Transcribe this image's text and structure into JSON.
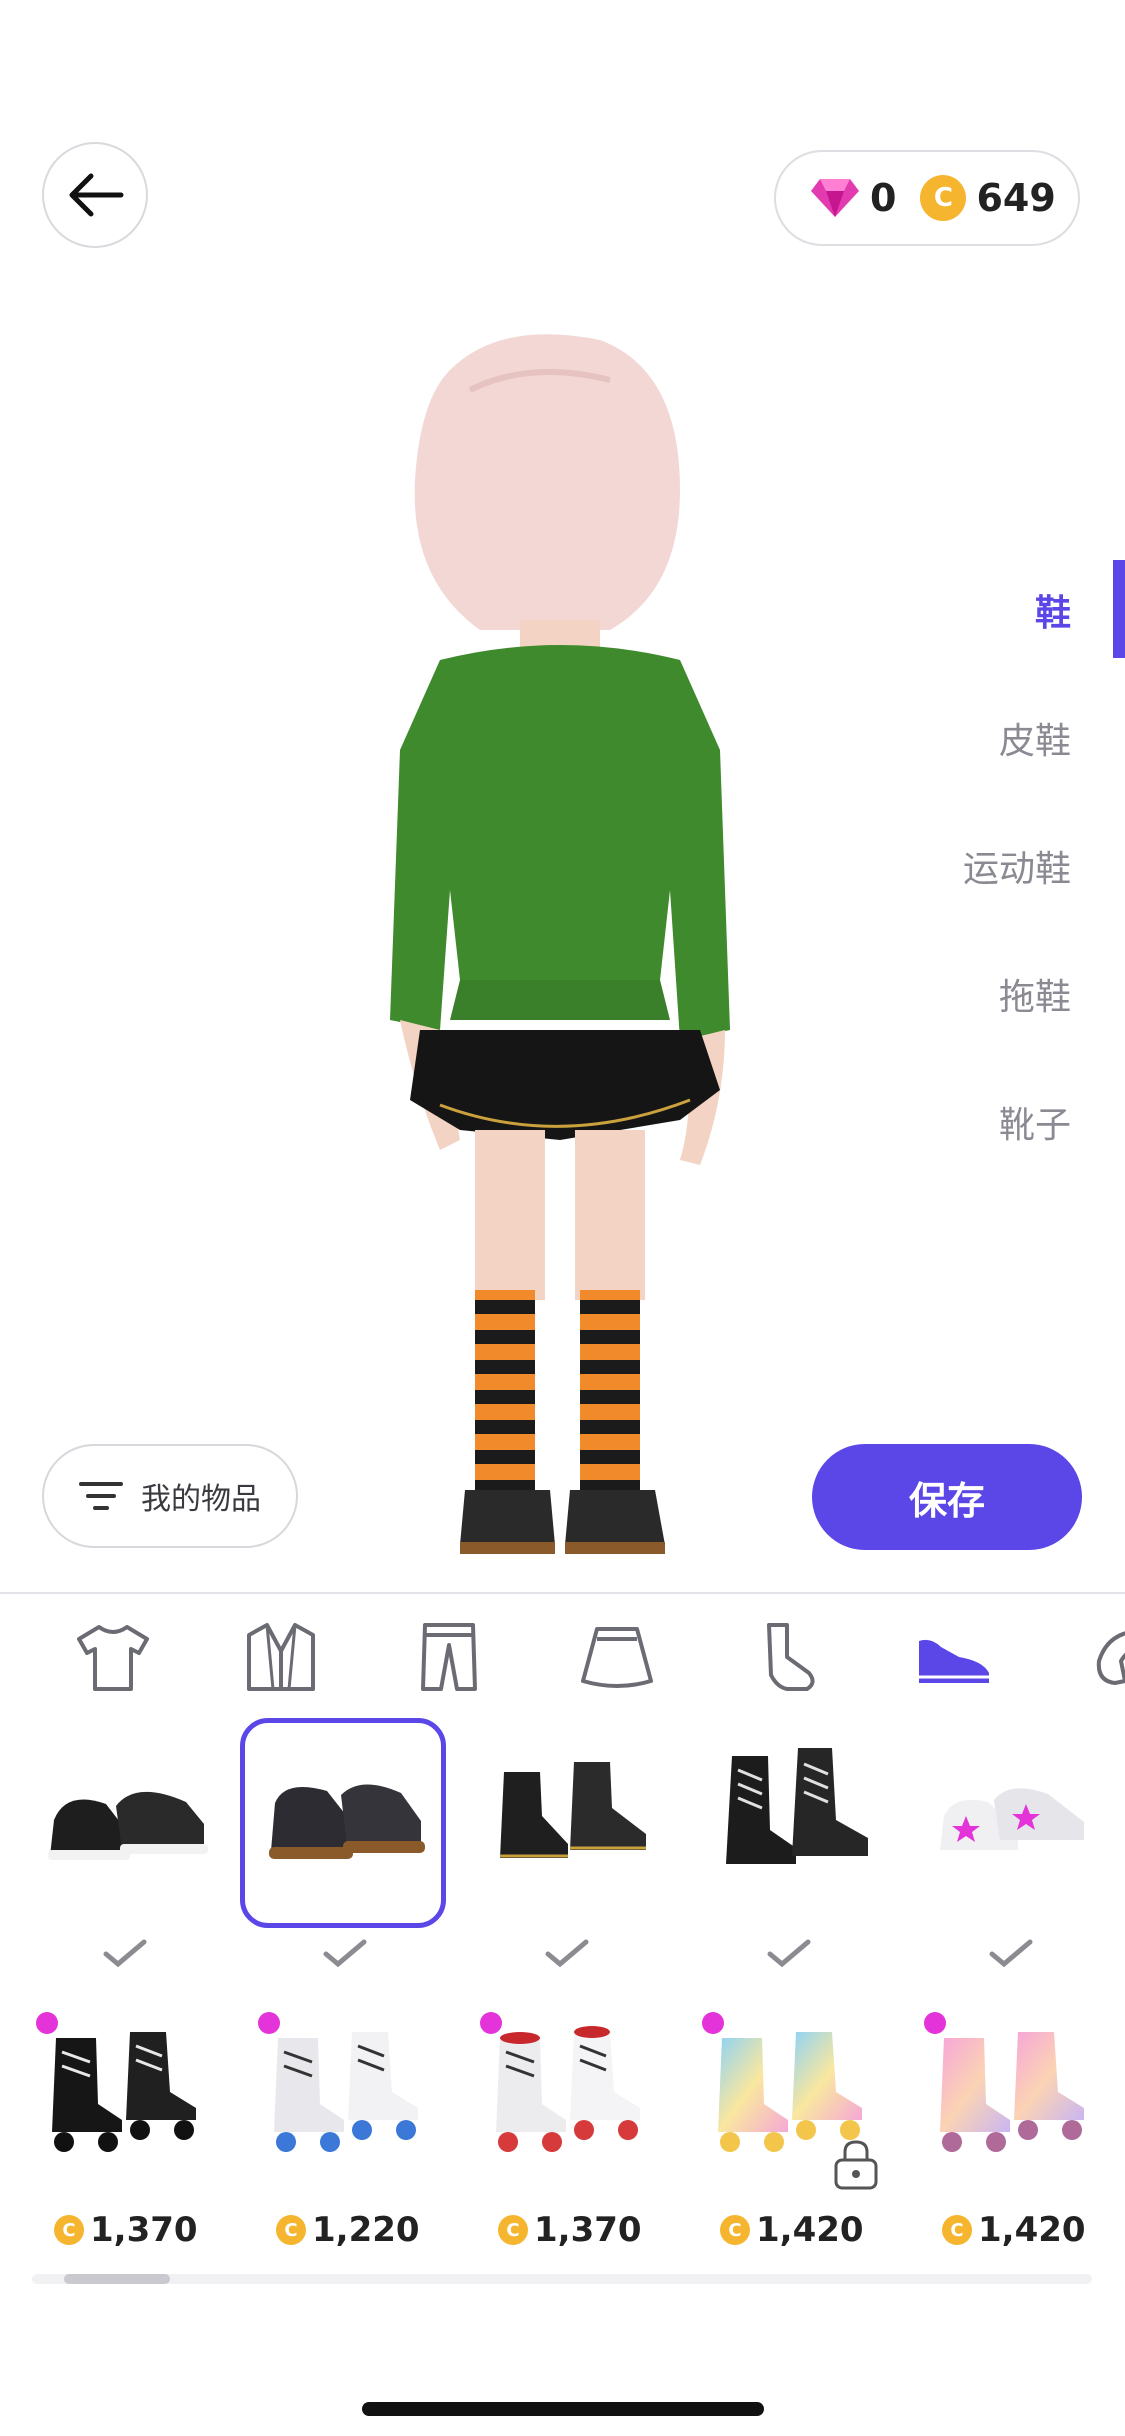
{
  "header": {
    "gems": "0",
    "coins": "649",
    "coin_symbol": "C"
  },
  "categories": {
    "items": [
      "鞋",
      "皮鞋",
      "运动鞋",
      "拖鞋",
      "靴子"
    ],
    "active_index": 0
  },
  "actions": {
    "my_items_label": "我的物品",
    "save_label": "保存"
  },
  "tabs": [
    "t-shirt-icon",
    "jacket-icon",
    "pants-icon",
    "skirt-icon",
    "socks-icon",
    "shoes-icon",
    "accessory-icon"
  ],
  "tabs_active": "shoes-icon",
  "owned_items": [
    {
      "name": "slip-on-shoes",
      "selected": false
    },
    {
      "name": "black-loafers",
      "selected": true
    },
    {
      "name": "black-ankle-boots",
      "selected": false
    },
    {
      "name": "black-lace-up-boots",
      "selected": false
    },
    {
      "name": "white-star-sneakers",
      "selected": false
    }
  ],
  "shop_items": [
    {
      "name": "black-roller-skates",
      "price": "1,370",
      "locked": false
    },
    {
      "name": "white-blue-roller-skates",
      "price": "1,220",
      "locked": false
    },
    {
      "name": "white-red-roller-skates",
      "price": "1,370",
      "locked": false
    },
    {
      "name": "pastel-roller-skates",
      "price": "1,420",
      "locked": true
    },
    {
      "name": "pink-pastel-roller-skates",
      "price": "1,420",
      "locked": false
    }
  ],
  "colors": {
    "accent": "#5b46e8",
    "coin": "#f6b52e",
    "gem": "#e23bb0",
    "new_dot": "#e433d9"
  }
}
